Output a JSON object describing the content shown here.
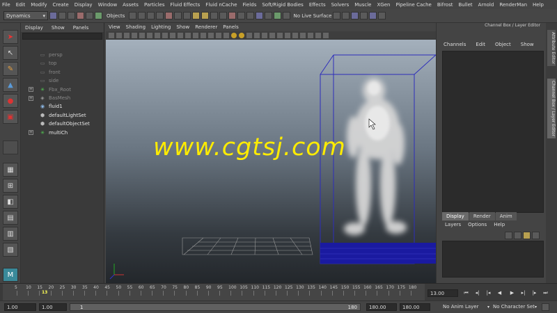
{
  "menubar": [
    "File",
    "Edit",
    "Modify",
    "Create",
    "Display",
    "Window",
    "Assets",
    "Particles",
    "Fluid Effects",
    "Fluid nCache",
    "Fields",
    "Soft/Rigid Bodies",
    "Effects",
    "Solvers",
    "Muscle",
    "XGen",
    "Pipeline Cache",
    "Bifrost",
    "Bullet",
    "Arnold",
    "RenderMan",
    "Help"
  ],
  "statusline": {
    "mode": "Dynamics",
    "objects_label": "Objects",
    "live_surface": "No Live Surface"
  },
  "outliner": {
    "menu": [
      "Display",
      "Show",
      "Panels"
    ],
    "items": [
      {
        "label": "persp",
        "icon": "camera-icon",
        "dim": true,
        "expand": ""
      },
      {
        "label": "top",
        "icon": "camera-icon",
        "dim": true,
        "expand": ""
      },
      {
        "label": "front",
        "icon": "camera-icon",
        "dim": true,
        "expand": ""
      },
      {
        "label": "side",
        "icon": "camera-icon",
        "dim": true,
        "expand": ""
      },
      {
        "label": "Fbx_Root",
        "icon": "joint-icon",
        "dim": true,
        "expand": "+"
      },
      {
        "label": "BasMesh",
        "icon": "mesh-icon",
        "dim": true,
        "expand": "+"
      },
      {
        "label": "fluid1",
        "icon": "fluid-icon",
        "dim": false,
        "expand": ""
      },
      {
        "label": "defaultLightSet",
        "icon": "set-icon",
        "dim": false,
        "expand": ""
      },
      {
        "label": "defaultObjectSet",
        "icon": "set-icon",
        "dim": false,
        "expand": ""
      },
      {
        "label": "multiCh",
        "icon": "joint-icon",
        "dim": false,
        "expand": "+"
      }
    ]
  },
  "viewport": {
    "menu": [
      "View",
      "Shading",
      "Lighting",
      "Show",
      "Renderer",
      "Panels"
    ],
    "watermark": "www.cgtsj.com",
    "camera": "persp"
  },
  "channelbox": {
    "title": "Channel Box / Layer Editor",
    "menu": [
      "Channels",
      "Edit",
      "Object",
      "Show"
    ],
    "layer_tabs": [
      "Display",
      "Render",
      "Anim"
    ],
    "layer_menu": [
      "Layers",
      "Options",
      "Help"
    ]
  },
  "sidetabs": [
    "Attribute Editor",
    "Channel Box / Layer Editor"
  ],
  "timeline": {
    "ticks": [
      "5",
      "10",
      "15",
      "20",
      "25",
      "30",
      "35",
      "40",
      "45",
      "50",
      "55",
      "60",
      "65",
      "70",
      "75",
      "80",
      "85",
      "90",
      "95",
      "100",
      "105",
      "110",
      "115",
      "120",
      "125",
      "130",
      "135",
      "140",
      "145",
      "150",
      "155",
      "160",
      "165",
      "170",
      "175",
      "180"
    ],
    "current_frame": "13",
    "frame_field": "13.00"
  },
  "range": {
    "start": "1.00",
    "inner_start": "1.00",
    "slider_start": "1",
    "slider_end": "180",
    "end": "180.00",
    "anim_end": "180.00",
    "anim_layer": "No Anim Layer",
    "character_set": "No Character Set"
  },
  "colors": {
    "accent": "#ffec00",
    "fluid_grid": "#1a1aa0",
    "container": "#2d2dbb"
  }
}
